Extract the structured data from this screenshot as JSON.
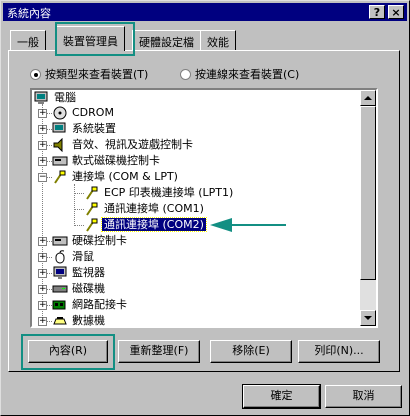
{
  "window": {
    "title": "系統內容",
    "help_glyph": "?",
    "close_glyph": "×"
  },
  "tabs": [
    {
      "label": "一般"
    },
    {
      "label": "裝置管理員"
    },
    {
      "label": "硬體設定檔"
    },
    {
      "label": "效能"
    }
  ],
  "view_options": {
    "by_type": "按類型來查看裝置(T)",
    "by_connection": "按連線來查看裝置(C)",
    "selected": "by_type"
  },
  "tree": {
    "root": "電腦",
    "items": [
      {
        "label": "CDROM"
      },
      {
        "label": "系統裝置"
      },
      {
        "label": "音效、視訊及遊戲控制卡"
      },
      {
        "label": "軟式磁碟機控制卡"
      },
      {
        "label": "連接埠 (COM & LPT)"
      },
      {
        "label": "ECP 印表機連接埠 (LPT1)"
      },
      {
        "label": "通訊連接埠 (COM1)"
      },
      {
        "label": "通訊連接埠 (COM2)"
      },
      {
        "label": "硬碟控制卡"
      },
      {
        "label": "滑鼠"
      },
      {
        "label": "監視器"
      },
      {
        "label": "磁碟機"
      },
      {
        "label": "網路配接卡"
      },
      {
        "label": "數據機"
      }
    ],
    "selected_item": "通訊連接埠 (COM2)"
  },
  "buttons": {
    "properties": "內容(R)",
    "refresh": "重新整理(F)",
    "remove": "移除(E)",
    "print": "列印(N)..."
  },
  "footer": {
    "ok": "確定",
    "cancel": "取消"
  },
  "colors": {
    "titlebar": "#000080",
    "highlight_box": "#138f83",
    "arrow": "#138f83",
    "face": "#c0c0c0"
  }
}
